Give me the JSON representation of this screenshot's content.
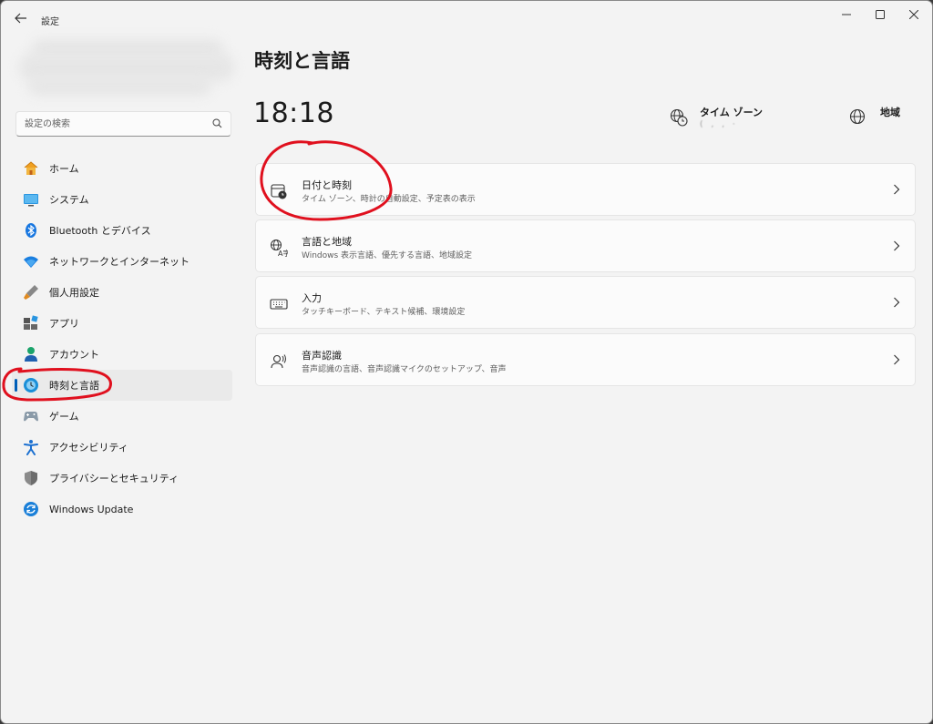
{
  "window": {
    "app_title": "設定",
    "back_icon": "back-arrow-icon",
    "controls": [
      "minimize-icon",
      "maximize-icon",
      "close-icon"
    ]
  },
  "search": {
    "placeholder": "設定の検索",
    "icon": "search-icon"
  },
  "sidebar": {
    "items": [
      {
        "label": "ホーム",
        "icon": "home-icon"
      },
      {
        "label": "システム",
        "icon": "system-icon"
      },
      {
        "label": "Bluetooth とデバイス",
        "icon": "bluetooth-icon"
      },
      {
        "label": "ネットワークとインターネット",
        "icon": "wifi-icon"
      },
      {
        "label": "個人用設定",
        "icon": "personalization-icon"
      },
      {
        "label": "アプリ",
        "icon": "apps-icon"
      },
      {
        "label": "アカウント",
        "icon": "account-icon"
      },
      {
        "label": "時刻と言語",
        "icon": "time-language-icon",
        "selected": true
      },
      {
        "label": "ゲーム",
        "icon": "gamepad-icon"
      },
      {
        "label": "アクセシビリティ",
        "icon": "accessibility-icon"
      },
      {
        "label": "プライバシーとセキュリティ",
        "icon": "shield-icon"
      },
      {
        "label": "Windows Update",
        "icon": "windows-update-icon"
      }
    ]
  },
  "main": {
    "page_title": "時刻と言語",
    "clock": "18:18",
    "time_zone": {
      "label": "タイム ゾーン",
      "value": "( ‚ ‚ ·",
      "icon": "globe-clock-icon"
    },
    "region": {
      "label": "地域",
      "icon": "globe-icon"
    },
    "cards": [
      {
        "title": "日付と時刻",
        "description": "タイム ゾーン、時計の自動設定、予定表の表示",
        "icon": "calendar-clock-icon"
      },
      {
        "title": "言語と地域",
        "description": "Windows 表示言語、優先する言語、地域設定",
        "icon": "language-icon"
      },
      {
        "title": "入力",
        "description": "タッチキーボード、テキスト候補、環境設定",
        "icon": "keyboard-icon"
      },
      {
        "title": "音声認識",
        "description": "音声認識の言語、音声認識マイクのセットアップ、音声",
        "icon": "voice-icon"
      }
    ]
  },
  "colors": {
    "accent": "#005fb8",
    "annotation": "#e0101e",
    "background": "#f3f3f3",
    "card": "#fbfbfb"
  }
}
